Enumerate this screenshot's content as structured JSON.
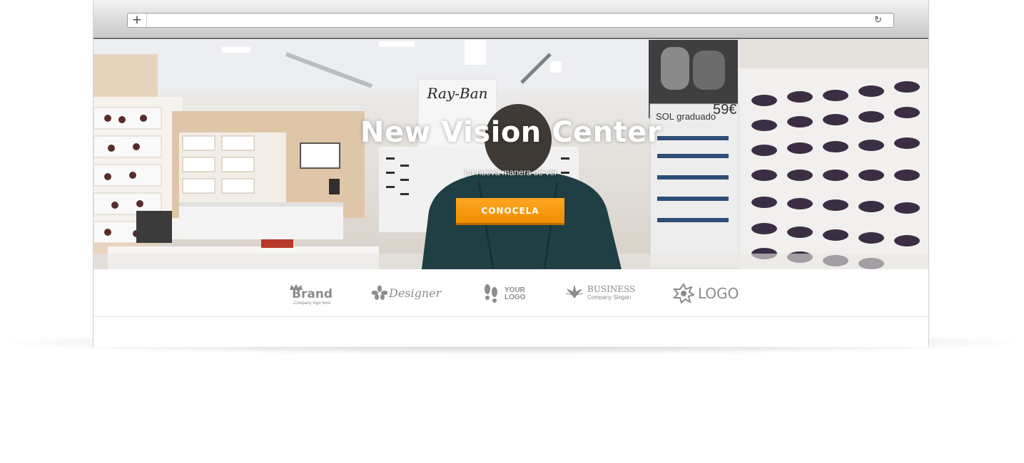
{
  "browser": {
    "new_tab_symbol": "+",
    "url": "",
    "reload_symbol": "↻"
  },
  "hero": {
    "title": "New Vision Center",
    "subtitle": "La nueva manera de ver",
    "cta_label": "CONOCELA",
    "accent_color": "#f39800",
    "store_sign": "Ray-Ban",
    "price_sign_label": "SOL graduado",
    "price_sign_value": "59€"
  },
  "logos": [
    {
      "name": "Brand",
      "tagline": "Company logo here",
      "icon": "crown-icon"
    },
    {
      "name": "Designer",
      "tagline": "",
      "icon": "flower-icon"
    },
    {
      "name": "YOUR",
      "name2": "LOGO",
      "icon": "footprints-icon"
    },
    {
      "name": "BUSINESS",
      "tagline": "Company Slogan",
      "icon": "leaf-icon"
    },
    {
      "name": "LOGO",
      "tagline": "",
      "icon": "starburst-icon"
    }
  ]
}
